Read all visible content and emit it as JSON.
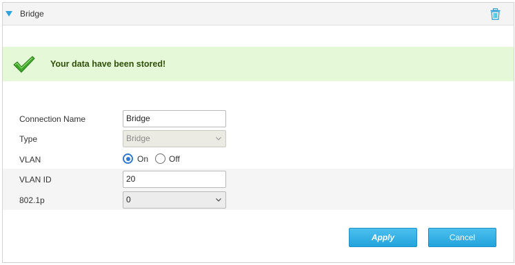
{
  "header": {
    "title": "Bridge",
    "collapse_icon": "caret-down-icon",
    "delete_icon": "trash-icon"
  },
  "message": {
    "text": "Your data have been stored!",
    "icon": "checkmark-icon",
    "color": "#e5f9d9"
  },
  "form": {
    "connection_name": {
      "label": "Connection Name",
      "value": "Bridge"
    },
    "type": {
      "label": "Type",
      "value": "Bridge"
    },
    "vlan": {
      "label": "VLAN",
      "options": [
        "On",
        "Off"
      ],
      "selected": "On"
    },
    "vlan_id": {
      "label": "VLAN ID",
      "value": "20"
    },
    "priority": {
      "label": "802.1p",
      "value": "0"
    }
  },
  "buttons": {
    "apply": "Apply",
    "cancel": "Cancel",
    "accent": "#23a3dd"
  }
}
